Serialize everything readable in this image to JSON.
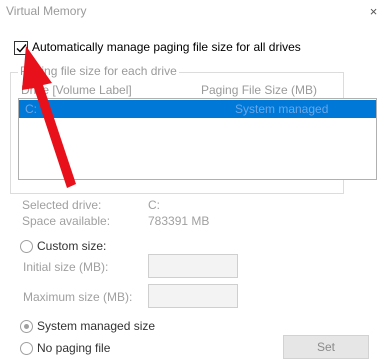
{
  "window": {
    "title": "Virtual Memory",
    "close_glyph": "×"
  },
  "auto_manage": {
    "label": "Automatically manage paging file size for all drives",
    "checked": true
  },
  "group": {
    "title": "Paging file size for each drive",
    "col_drive": "Drive [Volume Label]",
    "col_size": "Paging File Size (MB)",
    "rows": [
      {
        "drive": "C:",
        "size": "System managed",
        "selected": true
      }
    ]
  },
  "drive_info": {
    "selected_label": "Selected drive:",
    "selected_value": "C:",
    "space_label": "Space available:",
    "space_value": "783391 MB"
  },
  "options": {
    "custom_size": "Custom size:",
    "initial_size": "Initial size (MB):",
    "initial_value": "",
    "maximum_size": "Maximum size (MB):",
    "maximum_value": "",
    "system_managed": "System managed size",
    "no_paging": "No paging file",
    "selected_option": "system_managed"
  },
  "buttons": {
    "set": "Set"
  },
  "colors": {
    "selection": "#0078d7",
    "annotation_arrow": "#e8101a"
  },
  "icons": {
    "checkmark": "checkmark-icon",
    "annotation": "red-arrow-annotation-icon"
  }
}
